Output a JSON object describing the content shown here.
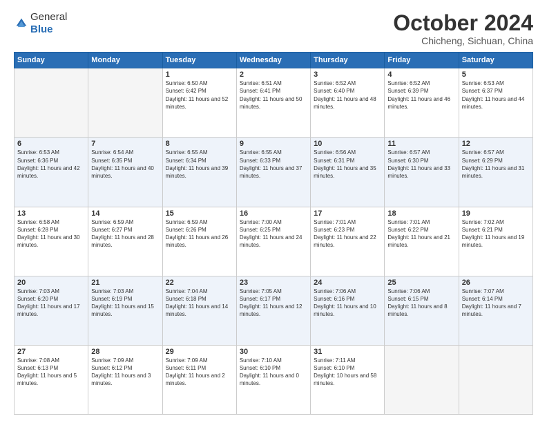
{
  "logo": {
    "general": "General",
    "blue": "Blue"
  },
  "title": "October 2024",
  "location": "Chicheng, Sichuan, China",
  "headers": [
    "Sunday",
    "Monday",
    "Tuesday",
    "Wednesday",
    "Thursday",
    "Friday",
    "Saturday"
  ],
  "weeks": [
    [
      {
        "day": "",
        "empty": true
      },
      {
        "day": "",
        "empty": true
      },
      {
        "day": "1",
        "sunrise": "6:50 AM",
        "sunset": "6:42 PM",
        "daylight": "11 hours and 52 minutes."
      },
      {
        "day": "2",
        "sunrise": "6:51 AM",
        "sunset": "6:41 PM",
        "daylight": "11 hours and 50 minutes."
      },
      {
        "day": "3",
        "sunrise": "6:52 AM",
        "sunset": "6:40 PM",
        "daylight": "11 hours and 48 minutes."
      },
      {
        "day": "4",
        "sunrise": "6:52 AM",
        "sunset": "6:39 PM",
        "daylight": "11 hours and 46 minutes."
      },
      {
        "day": "5",
        "sunrise": "6:53 AM",
        "sunset": "6:37 PM",
        "daylight": "11 hours and 44 minutes."
      }
    ],
    [
      {
        "day": "6",
        "sunrise": "6:53 AM",
        "sunset": "6:36 PM",
        "daylight": "11 hours and 42 minutes."
      },
      {
        "day": "7",
        "sunrise": "6:54 AM",
        "sunset": "6:35 PM",
        "daylight": "11 hours and 40 minutes."
      },
      {
        "day": "8",
        "sunrise": "6:55 AM",
        "sunset": "6:34 PM",
        "daylight": "11 hours and 39 minutes."
      },
      {
        "day": "9",
        "sunrise": "6:55 AM",
        "sunset": "6:33 PM",
        "daylight": "11 hours and 37 minutes."
      },
      {
        "day": "10",
        "sunrise": "6:56 AM",
        "sunset": "6:31 PM",
        "daylight": "11 hours and 35 minutes."
      },
      {
        "day": "11",
        "sunrise": "6:57 AM",
        "sunset": "6:30 PM",
        "daylight": "11 hours and 33 minutes."
      },
      {
        "day": "12",
        "sunrise": "6:57 AM",
        "sunset": "6:29 PM",
        "daylight": "11 hours and 31 minutes."
      }
    ],
    [
      {
        "day": "13",
        "sunrise": "6:58 AM",
        "sunset": "6:28 PM",
        "daylight": "11 hours and 30 minutes."
      },
      {
        "day": "14",
        "sunrise": "6:59 AM",
        "sunset": "6:27 PM",
        "daylight": "11 hours and 28 minutes."
      },
      {
        "day": "15",
        "sunrise": "6:59 AM",
        "sunset": "6:26 PM",
        "daylight": "11 hours and 26 minutes."
      },
      {
        "day": "16",
        "sunrise": "7:00 AM",
        "sunset": "6:25 PM",
        "daylight": "11 hours and 24 minutes."
      },
      {
        "day": "17",
        "sunrise": "7:01 AM",
        "sunset": "6:23 PM",
        "daylight": "11 hours and 22 minutes."
      },
      {
        "day": "18",
        "sunrise": "7:01 AM",
        "sunset": "6:22 PM",
        "daylight": "11 hours and 21 minutes."
      },
      {
        "day": "19",
        "sunrise": "7:02 AM",
        "sunset": "6:21 PM",
        "daylight": "11 hours and 19 minutes."
      }
    ],
    [
      {
        "day": "20",
        "sunrise": "7:03 AM",
        "sunset": "6:20 PM",
        "daylight": "11 hours and 17 minutes."
      },
      {
        "day": "21",
        "sunrise": "7:03 AM",
        "sunset": "6:19 PM",
        "daylight": "11 hours and 15 minutes."
      },
      {
        "day": "22",
        "sunrise": "7:04 AM",
        "sunset": "6:18 PM",
        "daylight": "11 hours and 14 minutes."
      },
      {
        "day": "23",
        "sunrise": "7:05 AM",
        "sunset": "6:17 PM",
        "daylight": "11 hours and 12 minutes."
      },
      {
        "day": "24",
        "sunrise": "7:06 AM",
        "sunset": "6:16 PM",
        "daylight": "11 hours and 10 minutes."
      },
      {
        "day": "25",
        "sunrise": "7:06 AM",
        "sunset": "6:15 PM",
        "daylight": "11 hours and 8 minutes."
      },
      {
        "day": "26",
        "sunrise": "7:07 AM",
        "sunset": "6:14 PM",
        "daylight": "11 hours and 7 minutes."
      }
    ],
    [
      {
        "day": "27",
        "sunrise": "7:08 AM",
        "sunset": "6:13 PM",
        "daylight": "11 hours and 5 minutes."
      },
      {
        "day": "28",
        "sunrise": "7:09 AM",
        "sunset": "6:12 PM",
        "daylight": "11 hours and 3 minutes."
      },
      {
        "day": "29",
        "sunrise": "7:09 AM",
        "sunset": "6:11 PM",
        "daylight": "11 hours and 2 minutes."
      },
      {
        "day": "30",
        "sunrise": "7:10 AM",
        "sunset": "6:10 PM",
        "daylight": "11 hours and 0 minutes."
      },
      {
        "day": "31",
        "sunrise": "7:11 AM",
        "sunset": "6:10 PM",
        "daylight": "10 hours and 58 minutes."
      },
      {
        "day": "",
        "empty": true
      },
      {
        "day": "",
        "empty": true
      }
    ]
  ],
  "labels": {
    "sunrise": "Sunrise:",
    "sunset": "Sunset:",
    "daylight": "Daylight:"
  }
}
